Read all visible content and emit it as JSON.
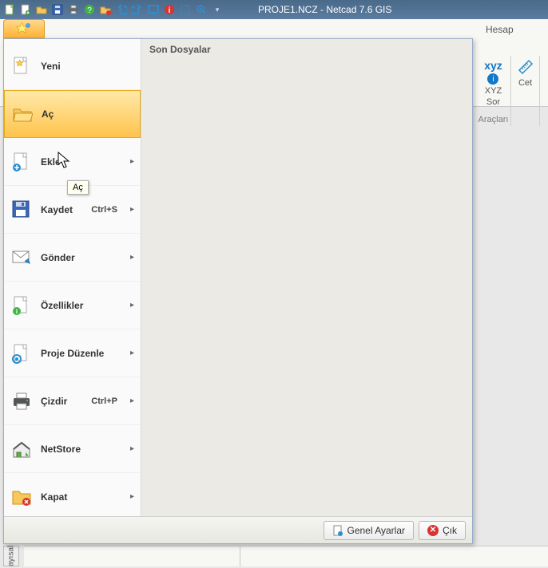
{
  "title": "PROJE1.NCZ - Netcad 7.6 GIS",
  "ribbon": {
    "tab_hesap": "Hesap",
    "xyz": "xyz",
    "xyz_label": "XYZ",
    "sor_label": "Sor",
    "araclari": "Araçları",
    "cet": "Cet"
  },
  "recent_header": "Son Dosyalar",
  "tooltip_ac": "Aç",
  "menu": {
    "yeni": "Yeni",
    "ac": "Aç",
    "ekle": "Ekle",
    "kaydet": "Kaydet",
    "kaydet_sc": "Ctrl+S",
    "gonder": "Gönder",
    "ozellikler": "Özellikler",
    "proje_duzenle": "Proje Düzenle",
    "cizdir": "Çizdir",
    "cizdir_sc": "Ctrl+P",
    "netstore": "NetStore",
    "kapat": "Kapat"
  },
  "footer": {
    "genel_ayarlar": "Genel Ayarlar",
    "cik": "Çık"
  },
  "sidetab": "ayısal"
}
